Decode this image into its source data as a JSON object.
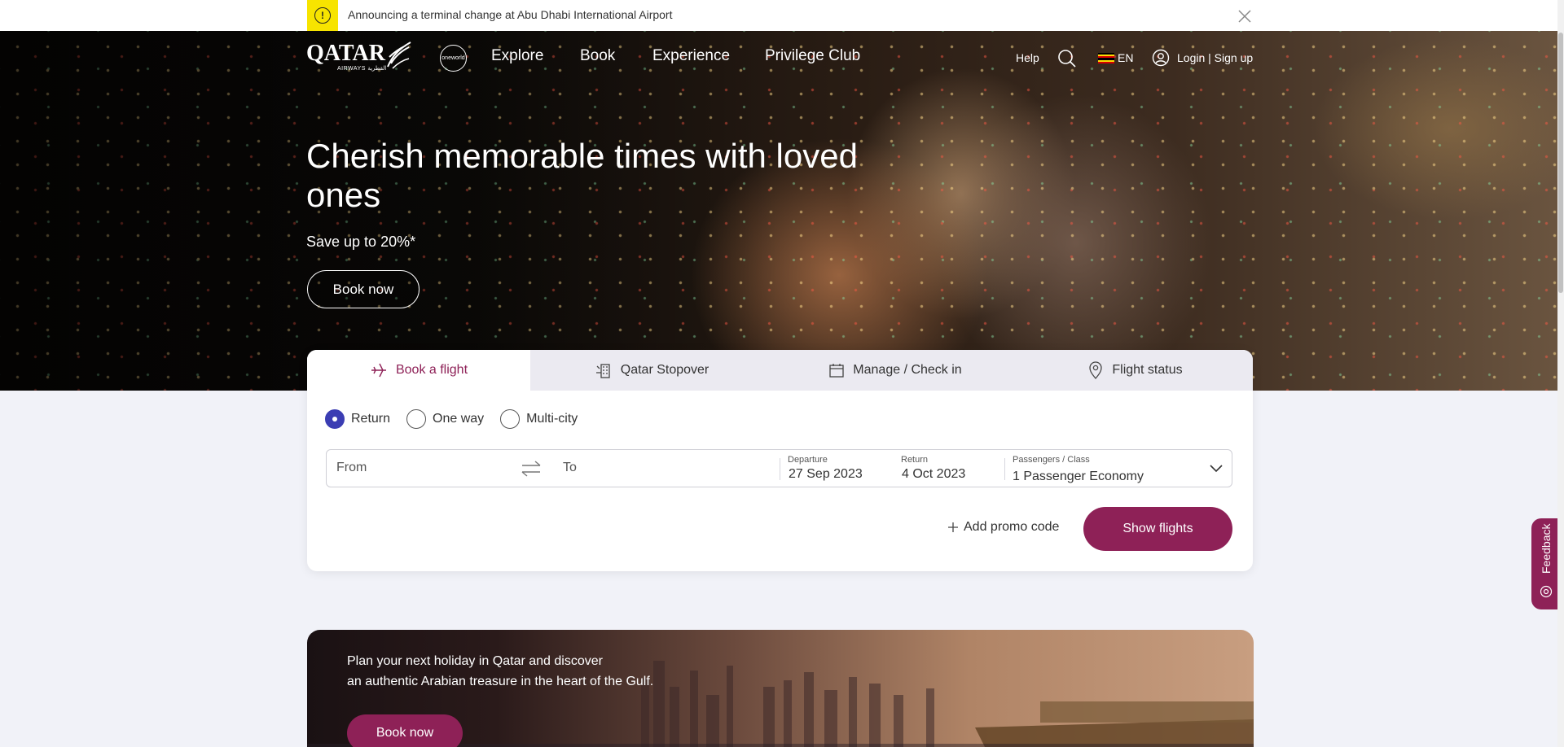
{
  "alert": {
    "icon": "warning-icon",
    "text": "Announcing a terminal change at Abu Dhabi International Airport",
    "close_icon": "close-icon"
  },
  "header": {
    "logo_text": "QATAR",
    "logo_sub": "AIRWAYS القطرية",
    "alliance": "oneworld",
    "nav": [
      "Explore",
      "Book",
      "Experience",
      "Privilege Club"
    ],
    "help": "Help",
    "language": "EN",
    "login": "Login | Sign up"
  },
  "hero": {
    "title": "Cherish memorable times with loved ones",
    "subtitle": "Save up to 20%*",
    "cta": "Book now"
  },
  "booking": {
    "tabs": [
      {
        "label": "Book a flight",
        "icon": "plane-icon",
        "active": true
      },
      {
        "label": "Qatar Stopover",
        "icon": "hotel-icon",
        "active": false
      },
      {
        "label": "Manage / Check in",
        "icon": "calendar-icon",
        "active": false
      },
      {
        "label": "Flight status",
        "icon": "location-pin-icon",
        "active": false
      }
    ],
    "trip_types": [
      "Return",
      "One way",
      "Multi-city"
    ],
    "selected_trip": "Return",
    "from_placeholder": "From",
    "to_placeholder": "To",
    "departure_label": "Departure",
    "departure_value": "27 Sep 2023",
    "return_label": "Return",
    "return_value": "4 Oct 2023",
    "pax_label": "Passengers / Class",
    "pax_value": "1  Passenger Economy",
    "promo": "Add promo code",
    "submit": "Show flights"
  },
  "banner": {
    "text_line1": "Plan your next holiday in Qatar and discover",
    "text_line2": "an authentic Arabian treasure in the heart of the Gulf.",
    "cta": "Book now"
  },
  "feedback": {
    "label": "Feedback"
  },
  "colors": {
    "brand": "#8e2157",
    "radio": "#3b3db3",
    "alert": "#f7e400",
    "page_bg": "#f1f2f8"
  }
}
